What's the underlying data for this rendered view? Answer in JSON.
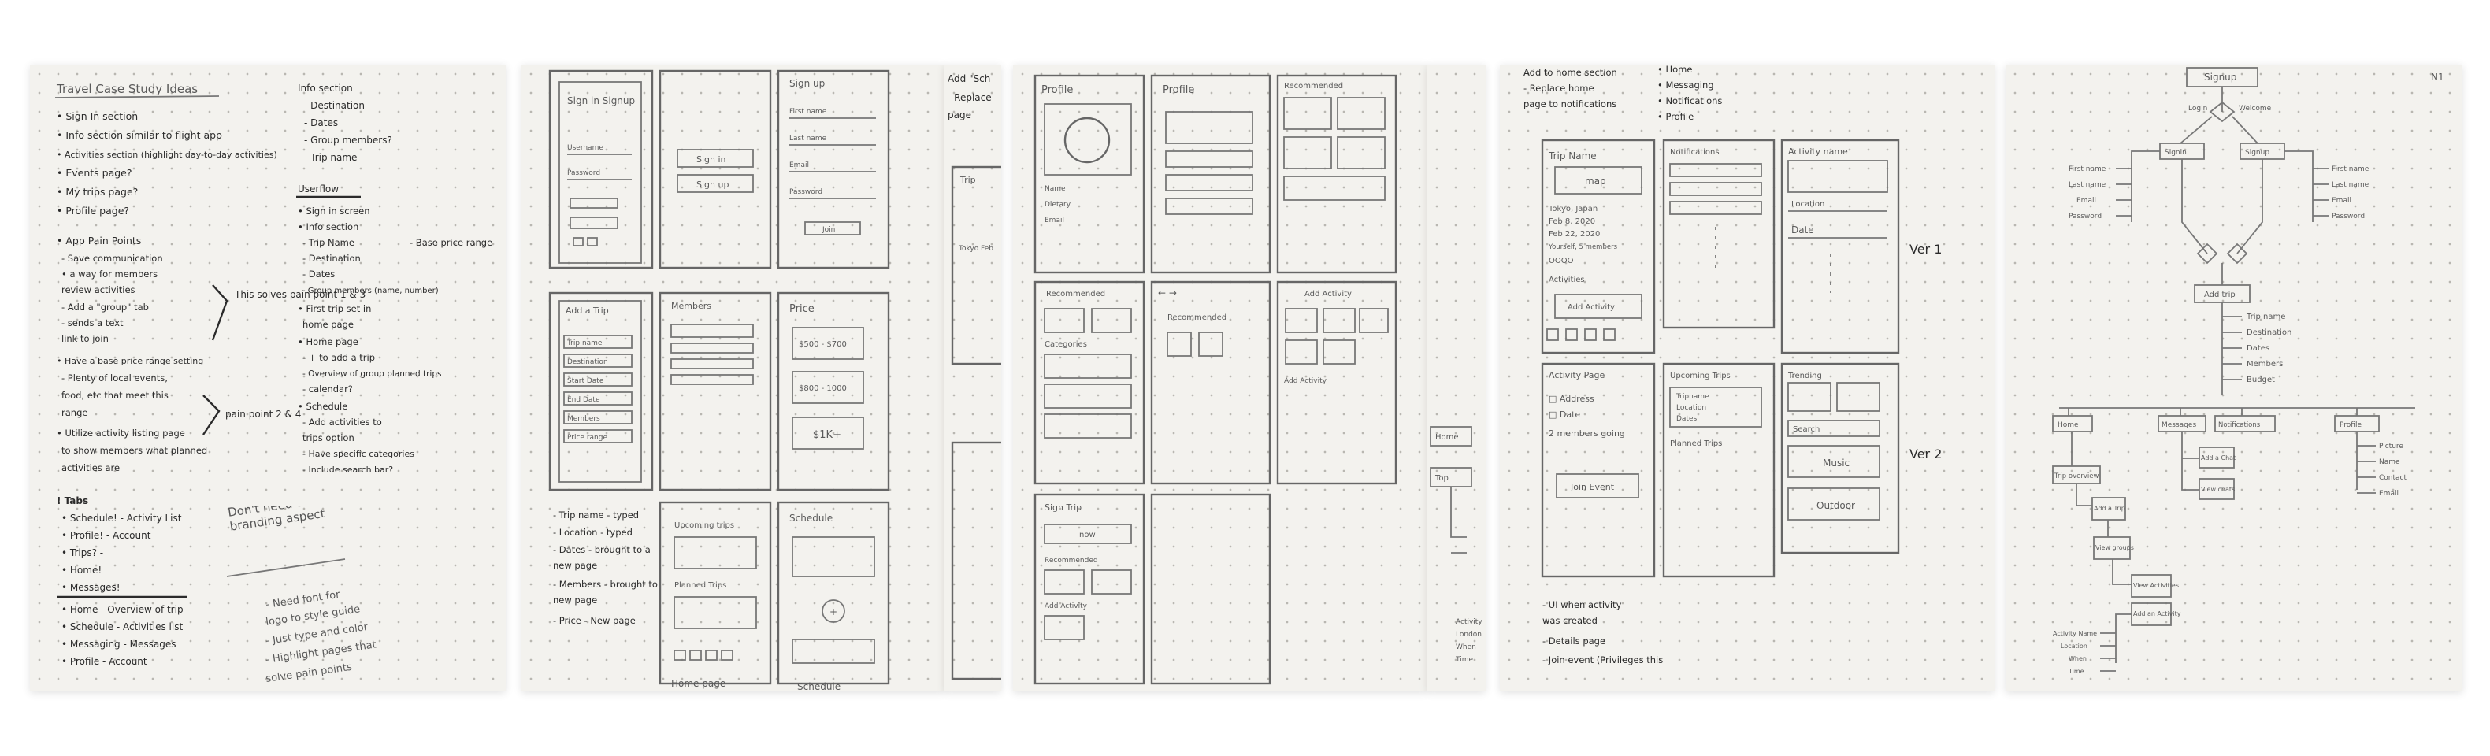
{
  "page1": {
    "title": "Travel Case Study Ideas",
    "notes_left": [
      "• Sign In section",
      "• Info section similar to flight app",
      "• Activities section (highlight day-to-day activities)",
      "• Events page?",
      "• My trips page?",
      "• Profile page?"
    ],
    "pain_points_heading": "• App Pain Points",
    "pain_points": [
      "- Save communication",
      "  • a way for members",
      "    review activities",
      "- Add a \"group\" tab",
      "  - sends a text",
      "    link to join",
      "• Have a base price range setting",
      "  - Plenty of local events,",
      "    food, etc that meet this",
      "    range",
      "• Utilize activity listing page",
      "  to show members what planned",
      "  activities are"
    ],
    "solves_note": "This solves pain point 1 & 3",
    "pain_point_24": "pain point 2 & 4",
    "info_heading": "Info section",
    "info_items": [
      "- Destination",
      "- Dates",
      "- Group members?",
      "- Trip name"
    ],
    "userflow_heading": "Userflow",
    "userflow_items": [
      "• Sign in screen",
      "• Info section",
      "  - Trip Name",
      "  - Destination",
      "  - Dates",
      "  - Group members (name, number)",
      "• First trip set in",
      "  home page",
      "• Home page",
      "  - + to add a trip",
      "  - Overview of group planned trips",
      "  - calendar?",
      "• Schedule",
      "  - Add activities to",
      "    trips option",
      "  - Have specific categories",
      "  - Include search bar?"
    ],
    "base_price_note": "- Base price range",
    "tabs_heading": "! Tabs",
    "tabs_items": [
      "• Schedule! - Activity List",
      "• Profile! - Account",
      "• Trips? -",
      "• Home!",
      "• Messages!"
    ],
    "nav_items": [
      "• Home - Overview of trip",
      "• Schedule - Activities list",
      "• Messaging - Messages",
      "• Profile - Account"
    ],
    "dont_need": "Don't need to make a branding aspect",
    "dont_need_list": [
      "- Need font for",
      "  logo to style guide",
      "- Just type and color",
      "- Highlight pages that",
      "  solve pain points"
    ]
  },
  "page2": {
    "labels": {
      "sign_in_signup": "Sign in Signup",
      "username": "Username",
      "password": "Password",
      "sign_in": "Sign in",
      "sign_up": "Sign up",
      "signup_title": "Sign up",
      "first_name": "First name",
      "last_name": "Last name",
      "email": "Email",
      "password2": "Password",
      "join": "Join",
      "add_trip": "Add a Trip",
      "trip_name": "Trip name",
      "destination": "Destination",
      "start_date": "Start Date",
      "end_date": "End Date",
      "members": "Members",
      "price_range": "Price range",
      "members_title": "Members",
      "price": "Price",
      "p1": "$500 - $700",
      "p2": "$800 - 1000",
      "p3": "$1K+",
      "upcoming_trips": "Upcoming trips",
      "planned_trips": "Planned Trips",
      "schedule": "Schedule",
      "home_page": "Home page",
      "schedule_bottom": "Schedule"
    },
    "notes": [
      "- Trip name - typed",
      "- Location - typed",
      "- Dates - brought to a",
      "  new page",
      "- Members - brought to",
      "  new page",
      "- Price - New page"
    ]
  },
  "page2b": {
    "edge_notes": [
      "Add \"Sch",
      "- Replace",
      "page"
    ],
    "trip_label": "Trip",
    "trip_sub": "Tokyo Feb",
    "home": "Home",
    "top_word": "Top"
  },
  "page3": {
    "labels": {
      "profile": "Profile",
      "name": "Name",
      "dietary": "Dietary",
      "email": "Email",
      "profile2": "Profile",
      "recommended": "Recommended",
      "recommended2": "Recommended",
      "categories": "Categories",
      "recommended3": "Recommended",
      "add_activity": "Add Activity",
      "add_activity2": "Add Activity",
      "sign_trip": "Sign Trip",
      "now": "now",
      "recommended4": "Recommended",
      "add_activity3": "Add Activity",
      "arrows": "←   →"
    }
  },
  "page3b": {
    "home": "Home",
    "top": "Top",
    "side_notes": [
      "Activity",
      "London",
      "When",
      "Time"
    ]
  },
  "page4": {
    "top_notes": [
      "Add to home section",
      "- Replace home",
      "page to notifications"
    ],
    "top_right": [
      "• Home",
      "• Messaging",
      "• Notifications",
      "• Profile"
    ],
    "labels": {
      "trip_name": "Trip Name",
      "map": "map",
      "city": "Tokyo, Japan",
      "dates1": "Feb 8, 2020",
      "dates2": "Feb 22, 2020",
      "members": "Yourself, 5 members",
      "avatars": "OOOO",
      "activities": "Activities",
      "add_activity": "Add Activity",
      "notifications": "Notifications",
      "activity_name": "Activity name",
      "location": "Location",
      "date": "Date",
      "ver1": "Ver 1",
      "ver2": "Ver 2",
      "activity_page": "Activity Page",
      "address": "□ Address",
      "date2": "□ Date",
      "members_going": "2 members going",
      "join_event": "Join Event",
      "upcoming_trips": "Upcoming Trips",
      "tripname": "Tripname",
      "location2": "Location",
      "dates": "Dates",
      "planned_trips": "Planned Trips",
      "trending": "Trending",
      "search": "Search",
      "music": "Music",
      "outdoor": "Outdoor"
    },
    "bottom_notes": [
      "- UI when activity",
      "  was created",
      "- Details page",
      "- Join event (Privileges this"
    ]
  },
  "page5": {
    "labels": {
      "signup": "Signup",
      "login": "Login",
      "welcome": "Welcome",
      "signin": "Signin",
      "signin2": "Signup",
      "first_name": "First name",
      "last_name": "Last name",
      "email": "Email",
      "password": "Password",
      "first_name2": "First name",
      "last_name2": "Last name",
      "email2": "Email",
      "password2": "Password",
      "add_trip": "Add trip",
      "trip_name": "Trip name",
      "destination": "Destination",
      "dates": "Dates",
      "members": "Members",
      "budget": "Budget",
      "home": "Home",
      "messages": "Messages",
      "notifications": "Notifications",
      "profile": "Profile",
      "trip_overview": "Trip overview",
      "add_trip2": "Add a Trip",
      "view_groups": "View groups",
      "add_chat": "Add a Chat",
      "view_chats": "View chats",
      "view_activities": "View Activities",
      "add_activity": "Add an Activity",
      "activity_name": "Activity Name",
      "location": "Location",
      "when": "When",
      "time": "Time",
      "picture": "Picture",
      "name": "Name",
      "contact": "Contact",
      "email3": "Email",
      "n1": "N1"
    }
  }
}
